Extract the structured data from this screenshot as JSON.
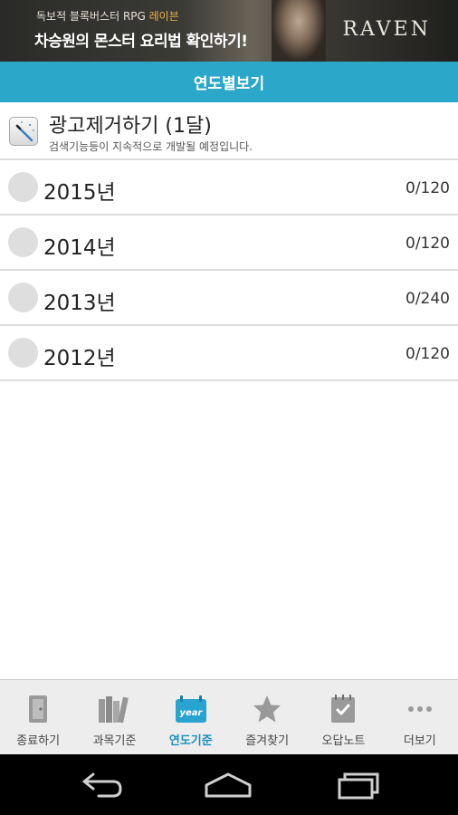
{
  "ad": {
    "line1_prefix": "독보적 블록버스터 RPG ",
    "line1_highlight": "레이븐",
    "line2": "차승원의 몬스터 요리법 확인하기!",
    "logo": "RAVEN"
  },
  "header": {
    "title": "연도별보기"
  },
  "promo": {
    "title": "광고제거하기 (1달)",
    "subtitle": "검색기능등이 지속적으로 개발될 예정입니다.",
    "icon": "wand-icon"
  },
  "years": [
    {
      "label": "2015년",
      "count": "0/120"
    },
    {
      "label": "2014년",
      "count": "0/120"
    },
    {
      "label": "2013년",
      "count": "0/240"
    },
    {
      "label": "2012년",
      "count": "0/120"
    }
  ],
  "tabs": [
    {
      "label": "종료하기",
      "icon": "exit-door-icon",
      "active": false
    },
    {
      "label": "과목기준",
      "icon": "books-icon",
      "active": false
    },
    {
      "label": "연도기준",
      "icon": "year-calendar-icon",
      "active": true
    },
    {
      "label": "즐겨찾기",
      "icon": "star-icon",
      "active": false
    },
    {
      "label": "오답노트",
      "icon": "notebook-check-icon",
      "active": false
    },
    {
      "label": "더보기",
      "icon": "more-dots-icon",
      "active": false
    }
  ],
  "icon_badge": {
    "year_text": "year"
  },
  "colors": {
    "header": "#2ba7c9",
    "active_tab": "#1a8fbe",
    "divider": "#dcdcdc",
    "circle": "#dedede"
  }
}
